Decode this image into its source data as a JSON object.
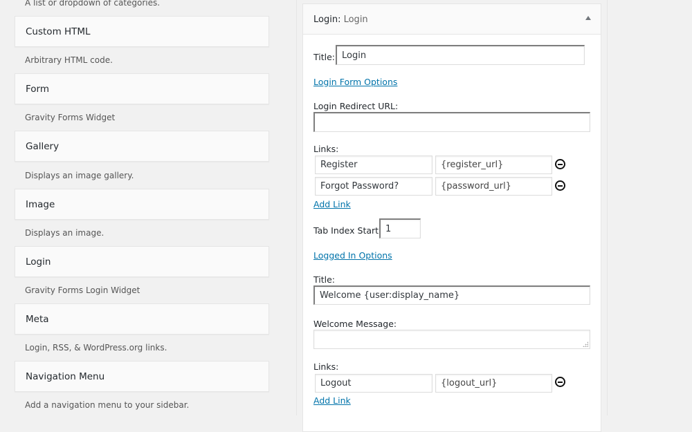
{
  "available_widgets": {
    "top_description": "A list or dropdown of categories.",
    "items": [
      {
        "title": "Custom HTML",
        "description": "Arbitrary HTML code."
      },
      {
        "title": "Form",
        "description": "Gravity Forms Widget"
      },
      {
        "title": "Gallery",
        "description": "Displays an image gallery."
      },
      {
        "title": "Image",
        "description": "Displays an image."
      },
      {
        "title": "Login",
        "description": "Gravity Forms Login Widget"
      },
      {
        "title": "Meta",
        "description": "Login, RSS, & WordPress.org links."
      },
      {
        "title": "Navigation Menu",
        "description": "Add a navigation menu to your sidebar."
      }
    ]
  },
  "widget_panel": {
    "type_label": "Login:",
    "instance_title": "Login",
    "toggle_icon": "triangle-up-icon",
    "title_label": "Title:",
    "title_value": "Login",
    "login_form_options_link": "Login Form Options",
    "redirect_label": "Login Redirect URL:",
    "redirect_value": "",
    "links_label": "Links:",
    "login_links": [
      {
        "text": "Register",
        "url": "{register_url}"
      },
      {
        "text": "Forgot Password?",
        "url": "{password_url}"
      }
    ],
    "add_link": "Add Link",
    "tab_index_label": "Tab Index Start:",
    "tab_index_value": "1",
    "logged_in_options_link": "Logged In Options",
    "logged_in_title_label": "Title:",
    "logged_in_title_value": "Welcome {user:display_name}",
    "welcome_message_label": "Welcome Message:",
    "welcome_message_value": "",
    "logged_in_links_label": "Links:",
    "logged_in_links": [
      {
        "text": "Logout",
        "url": "{logout_url}"
      }
    ],
    "logged_in_add_link": "Add Link"
  },
  "colors": {
    "link": "#0073aa",
    "background": "#f1f1f1"
  }
}
